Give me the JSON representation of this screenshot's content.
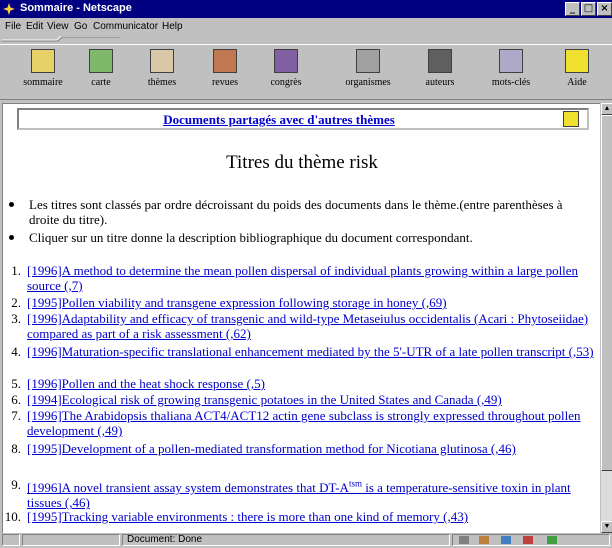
{
  "window": {
    "title": "Sommaire - Netscape"
  },
  "menu": [
    "File",
    "Edit",
    "View",
    "Go",
    "Communicator",
    "Help"
  ],
  "toolbar": [
    {
      "label": "sommaire",
      "icon": "sommaire-icon",
      "color": "#e8d068"
    },
    {
      "label": "carte",
      "icon": "map-icon",
      "color": "#7fb86a"
    },
    {
      "label": "thèmes",
      "icon": "themes-icon",
      "color": "#d8c8a8"
    },
    {
      "label": "revues",
      "icon": "journals-icon",
      "color": "#c07850"
    },
    {
      "label": "congrès",
      "icon": "congress-icon",
      "color": "#8060a0"
    },
    {
      "label": "organismes",
      "icon": "organisms-icon",
      "color": "#a0a0a0"
    },
    {
      "label": "auteurs",
      "icon": "authors-icon",
      "color": "#606060"
    },
    {
      "label": "mots-clés",
      "icon": "keywords-icon",
      "color": "#b0a8c8"
    },
    {
      "label": "Aide",
      "icon": "help-icon",
      "color": "#f0e030"
    }
  ],
  "frame_link": "Documents partagés avec d'autres thèmes",
  "page_title": "Titres du thème risk",
  "bullets": [
    "Les titres sont classés par ordre décroissant du poids des documents dans le thème.(entre parenthèses à droite du titre).",
    "Cliquer sur un titre donne la description bibliographique du document correspondant."
  ],
  "items": [
    {
      "num": "1.",
      "text": "[1996]A method to determine the mean pollen dispersal of individual plants growing within a large pollen source (,7)"
    },
    {
      "num": "2.",
      "text": "[1995]Pollen viability and transgene expression following storage in honey (,69)"
    },
    {
      "num": "3.",
      "text": "[1996]Adaptability and efficacy of transgenic and wild-type Metaseiulus occidentalis (Acari : Phytoseiidae) compared as part of a risk assessment (,62)"
    },
    {
      "num": "4.",
      "text": "[1996]Maturation-specific translational enhancement mediated by the 5'-UTR of a late pollen transcript (,53)"
    },
    {
      "num": "5.",
      "text": "[1996]Pollen and the heat shock response (,5)"
    },
    {
      "num": "6.",
      "text": "[1994]Ecological risk of growing transgenic potatoes in the United States and Canada (,49)"
    },
    {
      "num": "7.",
      "text": "[1996]The Arabidopsis thaliana ACT4/ACT12 actin gene subclass is strongly expressed throughout pollen development (,49)"
    },
    {
      "num": "8.",
      "text": "[1995]Development of a pollen-mediated transformation method for Nicotiana glutinosa (,46)"
    },
    {
      "num": "9.",
      "text_a": "[1996]A novel transient assay system demonstrates that DT-A",
      "sup": "tsm",
      "text_b": " is a temperature-sensitive toxin in plant tissues (,46)"
    },
    {
      "num": "10.",
      "text": "[1995]Tracking variable environments : there is more than one kind of memory (,43)"
    }
  ],
  "status": {
    "text": "Document: Done"
  }
}
